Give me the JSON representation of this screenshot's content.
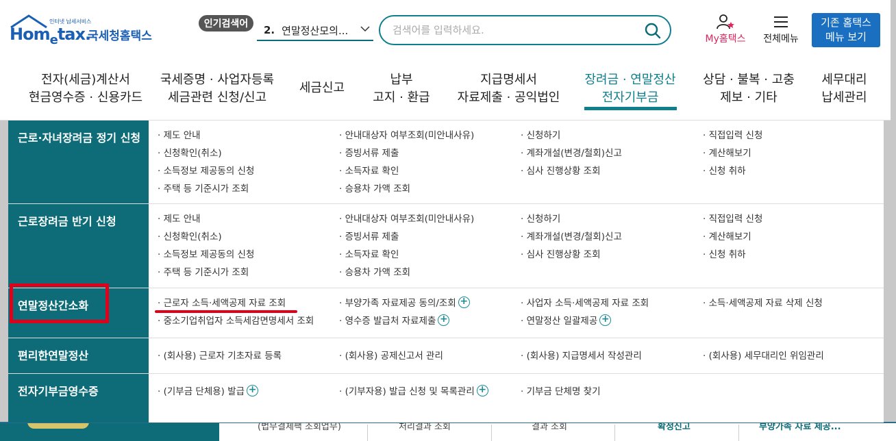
{
  "header": {
    "logo_small": "인터넷 납세서비스",
    "logo_brand_1": "Hom",
    "logo_brand_e": "e",
    "logo_brand_2": "tax.",
    "logo_kr": "국세청홈택스",
    "popular_label": "인기검색어",
    "popular_rank": "2.",
    "popular_text": "연말정산모의...",
    "search_placeholder": "검색어를 입력하세요.",
    "myhome_label": "My홈택스",
    "allmenu_label": "전체메뉴",
    "old_menu_line1": "기존 홈택스",
    "old_menu_line2": "메뉴 보기"
  },
  "gnb": [
    {
      "line1": "전자(세금)계산서",
      "line2": "현금영수증 · 신용카드",
      "active": false
    },
    {
      "line1": "국세증명 · 사업자등록",
      "line2": "세금관련 신청/신고",
      "active": false
    },
    {
      "line1": "세금신고",
      "line2": "",
      "active": false
    },
    {
      "line1": "납부",
      "line2": "고지 · 환급",
      "active": false
    },
    {
      "line1": "지급명세서",
      "line2": "자료제출 · 공익법인",
      "active": false
    },
    {
      "line1": "장려금 · 연말정산",
      "line2": "전자기부금",
      "active": true
    },
    {
      "line1": "상담 · 불복 · 고충",
      "line2": "제보 · 기타",
      "active": false
    },
    {
      "line1": "세무대리",
      "line2": "납세관리",
      "active": false
    }
  ],
  "mega": [
    {
      "category": "근로·자녀장려금 정기 신청",
      "items": [
        {
          "text": "· 제도 안내",
          "plus": false
        },
        {
          "text": "· 안내대상자 여부조회(미안내사유)",
          "plus": false
        },
        {
          "text": "· 신청하기",
          "plus": false
        },
        {
          "text": "· 직접입력 신청",
          "plus": false
        },
        {
          "text": "· 신청확인(취소)",
          "plus": false
        },
        {
          "text": "· 증빙서류 제출",
          "plus": false
        },
        {
          "text": "· 계좌개설(변경/철회)신고",
          "plus": false
        },
        {
          "text": "· 계산해보기",
          "plus": false
        },
        {
          "text": "· 소득정보 제공동의 신청",
          "plus": false
        },
        {
          "text": "· 소득자료 확인",
          "plus": false
        },
        {
          "text": "· 심사 진행상황 조회",
          "plus": false
        },
        {
          "text": "· 신청 취하",
          "plus": false
        },
        {
          "text": "· 주택 등 기준시가 조회",
          "plus": false
        },
        {
          "text": "· 승용차 가액 조회",
          "plus": false
        }
      ]
    },
    {
      "category": "근로장려금 반기 신청",
      "items": [
        {
          "text": "· 제도 안내",
          "plus": false
        },
        {
          "text": "· 안내대상자 여부조회(미안내사유)",
          "plus": false
        },
        {
          "text": "· 신청하기",
          "plus": false
        },
        {
          "text": "· 직접입력 신청",
          "plus": false
        },
        {
          "text": "· 신청확인(취소)",
          "plus": false
        },
        {
          "text": "· 증빙서류 제출",
          "plus": false
        },
        {
          "text": "· 계좌개설(변경/철회)신고",
          "plus": false
        },
        {
          "text": "· 계산해보기",
          "plus": false
        },
        {
          "text": "· 소득정보 제공동의 신청",
          "plus": false
        },
        {
          "text": "· 소득자료 확인",
          "plus": false
        },
        {
          "text": "· 심사 진행상황 조회",
          "plus": false
        },
        {
          "text": "· 신청 취하",
          "plus": false
        },
        {
          "text": "· 주택 등 기준시가 조회",
          "plus": false
        },
        {
          "text": "· 승용차 가액 조회",
          "plus": false
        }
      ]
    },
    {
      "category": "연말정산간소화",
      "items": [
        {
          "text": "· 근로자 소득·세액공제 자료 조회",
          "plus": false
        },
        {
          "text": "· 부양가족 자료제공 동의/조회",
          "plus": true
        },
        {
          "text": "· 사업자 소득·세액공제 자료 조회",
          "plus": false
        },
        {
          "text": "· 소득·세액공제 자료 삭제 신청",
          "plus": false
        },
        {
          "text": "· 중소기업취업자 소득세감면명세서 조회",
          "plus": false
        },
        {
          "text": "· 영수증 발급처 자료제출",
          "plus": true
        },
        {
          "text": "· 연말정산 일괄제공",
          "plus": true
        }
      ]
    },
    {
      "category": "편리한연말정산",
      "items": [
        {
          "text": "· (회사용) 근로자 기초자료 등록",
          "plus": false
        },
        {
          "text": "· (회사용) 공제신고서 관리",
          "plus": false
        },
        {
          "text": "· (회사용) 지급명세서 작성관리",
          "plus": false
        },
        {
          "text": "· (회사용) 세무대리인 위임관리",
          "plus": false
        }
      ]
    },
    {
      "category": "전자기부금영수증",
      "items": [
        {
          "text": "· (기부금 단체용) 발급",
          "plus": true
        },
        {
          "text": "· (기부자용) 발급 신청 및 목록관리",
          "plus": true
        },
        {
          "text": "· 기부금 단체명 찾기",
          "plus": false
        }
      ]
    }
  ],
  "bottom_tabs": [
    "(법무결제팩 조회업무)",
    "처리결과 조회",
    "결과 조회",
    "확정신고",
    "부양가족 자료 제공..."
  ],
  "colors": {
    "teal": "#0d6c77",
    "brand_blue": "#1a5fb4",
    "highlight_red": "#e0001a",
    "accent_pink": "#e0245e"
  }
}
